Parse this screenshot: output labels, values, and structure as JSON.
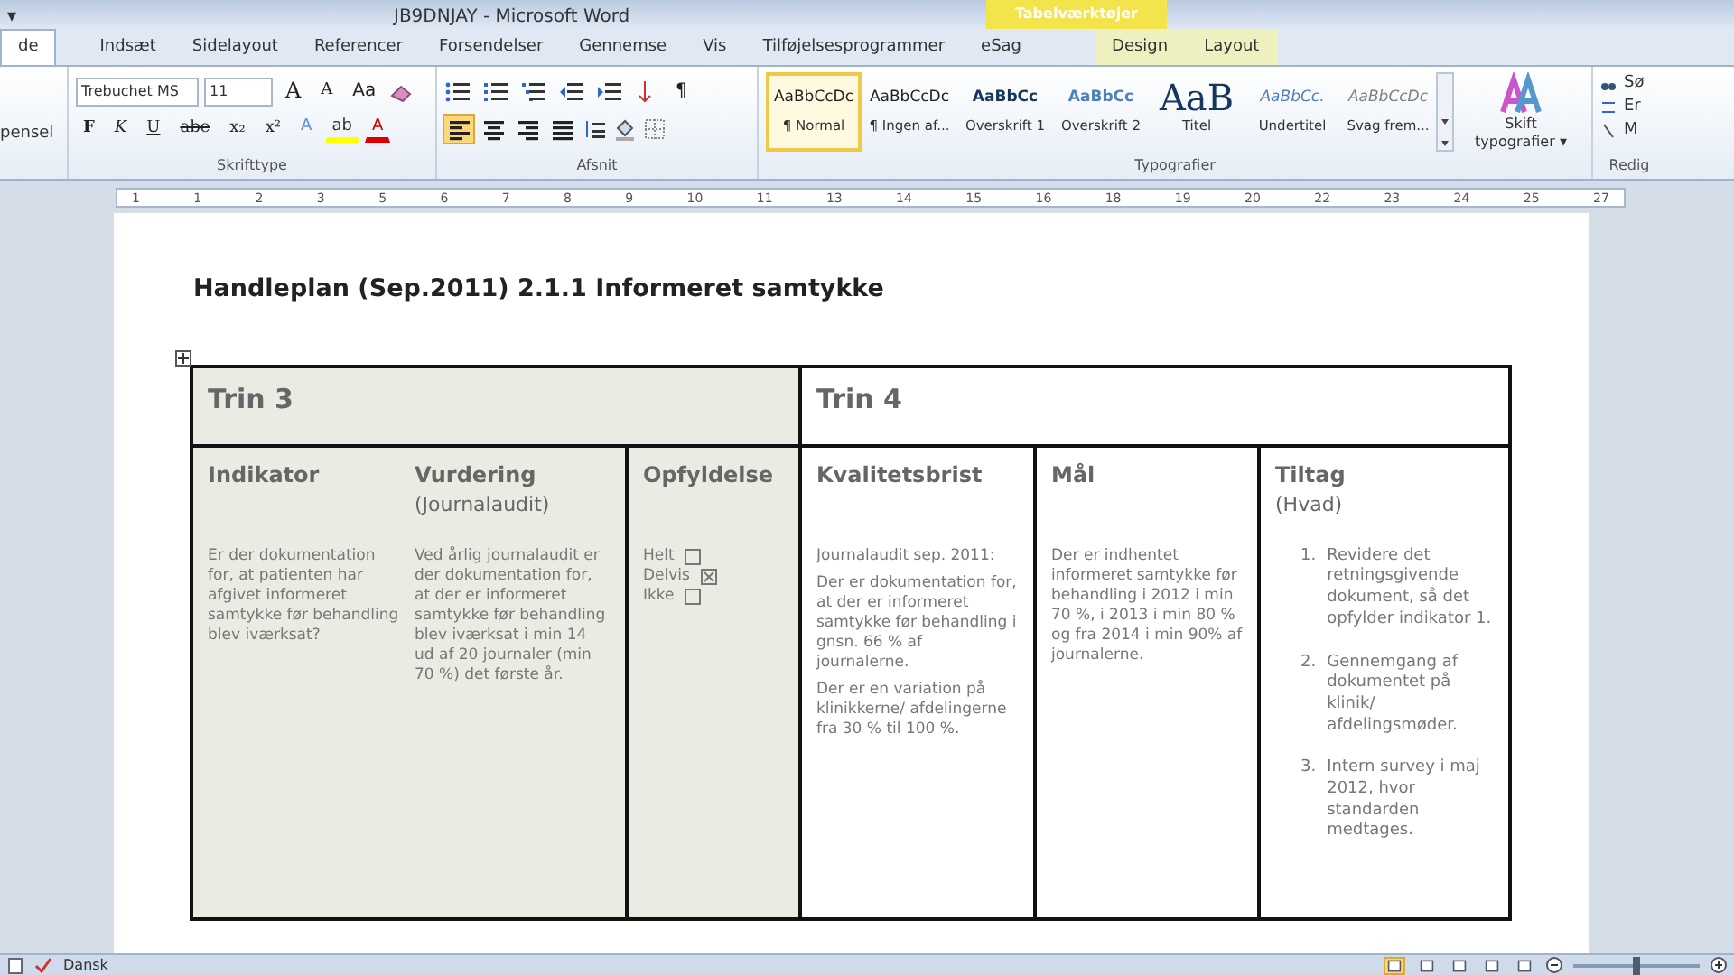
{
  "window": {
    "title": "JB9DNJAY - Microsoft Word",
    "quick_access": "▾",
    "context_group": "Tabelværktøjer"
  },
  "tabs": [
    {
      "label": "de",
      "selected": true,
      "context": false
    },
    {
      "label": "Indsæt",
      "selected": false,
      "context": false
    },
    {
      "label": "Sidelayout",
      "selected": false,
      "context": false
    },
    {
      "label": "Referencer",
      "selected": false,
      "context": false
    },
    {
      "label": "Forsendelser",
      "selected": false,
      "context": false
    },
    {
      "label": "Gennemse",
      "selected": false,
      "context": false
    },
    {
      "label": "Vis",
      "selected": false,
      "context": false
    },
    {
      "label": "Tilføjelsesprogrammer",
      "selected": false,
      "context": false
    },
    {
      "label": "eSag",
      "selected": false,
      "context": false
    },
    {
      "label": "Design",
      "selected": false,
      "context": true
    },
    {
      "label": "Layout",
      "selected": false,
      "context": true
    }
  ],
  "ribbon": {
    "clipboard_label": "pensel",
    "font": {
      "label": "Skrifttype",
      "name": "Trebuchet MS",
      "size": "11",
      "size_buttons": [
        "A",
        "A"
      ],
      "case_button": "Aa",
      "format_buttons": [
        "F",
        "K",
        "U",
        "abe",
        "x₂",
        "x²"
      ],
      "color_buttons": [
        "A",
        "ab",
        "A"
      ]
    },
    "paragraph": {
      "label": "Afsnit",
      "pilcrow": "¶",
      "alignment": [
        {
          "selected": true
        },
        {
          "selected": false
        },
        {
          "selected": false
        },
        {
          "selected": false
        }
      ]
    },
    "styles": {
      "label": "Typografier",
      "items": [
        {
          "preview": "AaBbCcDc",
          "name": "¶ Normal",
          "selected": true,
          "color": "#222222"
        },
        {
          "preview": "AaBbCcDc",
          "name": "¶ Ingen af...",
          "selected": false,
          "color": "#222222"
        },
        {
          "preview": "AaBbCc",
          "name": "Overskrift 1",
          "selected": false,
          "color": "#17365d"
        },
        {
          "preview": "AaBbCc",
          "name": "Overskrift 2",
          "selected": false,
          "color": "#4f81bd"
        },
        {
          "preview": "AaB",
          "name": "Titel",
          "selected": false,
          "color": "#17365d"
        },
        {
          "preview": "AaBbCc.",
          "name": "Undertitel",
          "selected": false,
          "color": "#4f81bd"
        },
        {
          "preview": "AaBbCcDc",
          "name": "Svag frem...",
          "selected": false,
          "color": "#808080"
        }
      ],
      "change_label": "Skift typografier ▾"
    },
    "editing": {
      "label": "Redig",
      "items": [
        "Sø",
        "Er",
        "M"
      ]
    }
  },
  "ruler": [
    "1",
    "1",
    "2",
    "3",
    "5",
    "6",
    "7",
    "8",
    "9",
    "10",
    "11",
    "13",
    "14",
    "15",
    "16",
    "18",
    "19",
    "20",
    "22",
    "23",
    "24",
    "25",
    "27"
  ],
  "document": {
    "title": "Handleplan (Sep.2011) 2.1.1 Informeret samtykke",
    "groups": [
      {
        "title": "Trin 3",
        "cells": [
          {
            "columns": [
              {
                "heading": "Indikator",
                "body": [
                  {
                    "kind": "text",
                    "text": "Er der dokumentation  for, at patienten  har afgivet informeret samtykke før behandling blev iværksat?"
                  }
                ]
              },
              {
                "heading": "Vurdering",
                "subheading": "(Journalaudit)",
                "body": [
                  {
                    "kind": "text",
                    "text": "Ved årlig journalaudit er der dokumentation for, at der er informeret samtykke før behandling  blev iværksat i min 14 ud af 20 journaler (min 70 %) det første år."
                  }
                ]
              }
            ]
          },
          {
            "columns": [
              {
                "heading": "Opfyldelse",
                "body": [
                  {
                    "kind": "check",
                    "text": "Helt",
                    "checked": false
                  },
                  {
                    "kind": "check",
                    "text": "Delvis",
                    "checked": true
                  },
                  {
                    "kind": "check",
                    "text": "Ikke",
                    "checked": false
                  }
                ]
              }
            ]
          }
        ]
      },
      {
        "title": "Trin 4",
        "cells": [
          {
            "columns": [
              {
                "heading": "Kvalitetsbrist",
                "body": [
                  {
                    "kind": "text",
                    "text": "Journalaudit sep. 2011:"
                  },
                  {
                    "kind": "text",
                    "text": "Der er dokumentation for, at der er informeret samtykke før behandling i gnsn. 66 % af journalerne."
                  },
                  {
                    "kind": "text",
                    "text": "Der er en variation  på klinikkerne/ afdelingerne fra 30 % til 100 %."
                  }
                ]
              }
            ]
          },
          {
            "columns": [
              {
                "heading": "Mål",
                "body": [
                  {
                    "kind": "text",
                    "text": "Der er indhentet informeret samtykke før behandling i 2012 i min 70 %, i 2013 i min 80 % og fra 2014 i min 90% af journalerne."
                  }
                ]
              }
            ]
          },
          {
            "columns": [
              {
                "heading": "Tiltag",
                "subheading": "(Hvad)",
                "body": [
                  {
                    "kind": "numbered",
                    "number": "1.",
                    "text": "Revidere det retningsgivende dokument, så det opfylder indikator 1."
                  },
                  {
                    "kind": "numbered",
                    "number": "2.",
                    "text": "Gennemgang af dokumentet på klinik/ afdelingsmøder."
                  },
                  {
                    "kind": "numbered",
                    "number": "3.",
                    "text": "Intern survey i maj 2012, hvor standarden medtages."
                  }
                ]
              }
            ]
          }
        ]
      }
    ]
  },
  "status_bar": {
    "language": "Dansk",
    "views": [
      {
        "selected": true
      },
      {
        "selected": false
      },
      {
        "selected": false
      },
      {
        "selected": false
      },
      {
        "selected": false
      }
    ],
    "zoom": {
      "level": 0.5
    }
  }
}
